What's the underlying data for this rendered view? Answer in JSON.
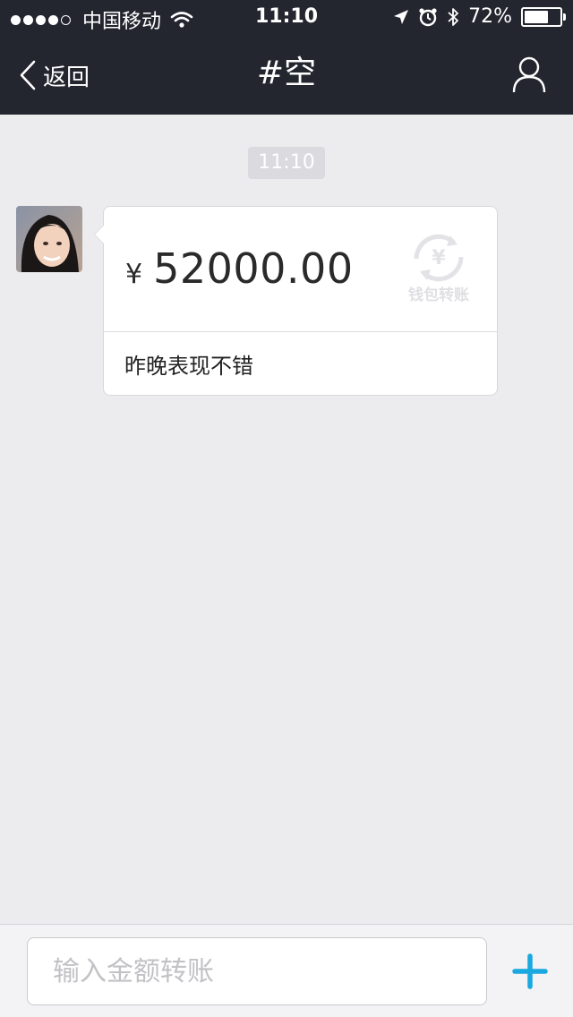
{
  "status_bar": {
    "carrier": "中国移动",
    "time": "11:10",
    "battery": "72%",
    "battery_level": 0.72,
    "signal_bars": 4
  },
  "navbar": {
    "back_label": "返回",
    "title": "#空",
    "icons": {
      "back": "chevron-left-icon",
      "user": "person-icon"
    }
  },
  "chat": {
    "timestamp": "11:10",
    "message": {
      "currency_symbol": "¥",
      "amount": "52000.00",
      "watermark": "钱包转账",
      "note": "昨晚表现不错"
    }
  },
  "input_bar": {
    "placeholder": "输入金额转账",
    "value": "",
    "icons": {
      "add": "plus-icon"
    }
  },
  "colors": {
    "topbar": "#23252f",
    "background": "#ececee",
    "accent": "#19a8e0"
  }
}
